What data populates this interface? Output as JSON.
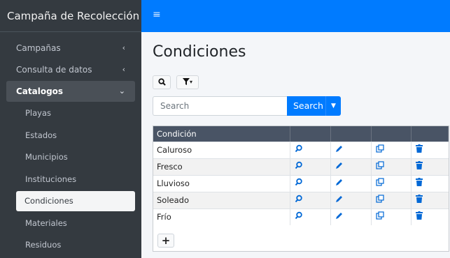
{
  "sidebar": {
    "brand": "Campaña de Recolección",
    "items": [
      {
        "label": "Campañas",
        "chevron": "‹"
      },
      {
        "label": "Consulta de datos",
        "chevron": "‹"
      },
      {
        "label": "Catalogos",
        "chevron": "⌄"
      }
    ],
    "subitems": [
      {
        "label": "Playas"
      },
      {
        "label": "Estados"
      },
      {
        "label": "Municipios"
      },
      {
        "label": "Instituciones"
      },
      {
        "label": "Condiciones"
      },
      {
        "label": "Materiales"
      },
      {
        "label": "Residuos"
      }
    ]
  },
  "topbar": {
    "menu_icon": "≡"
  },
  "main": {
    "title": "Condiciones",
    "toolbar": {
      "search_icon": "🔍",
      "filter_icon": "▼·"
    },
    "search": {
      "placeholder": "Search",
      "button_label": "Search",
      "dropdown_caret": "▼"
    },
    "table": {
      "headers": [
        "Condición",
        "",
        "",
        "",
        ""
      ],
      "rows": [
        "Caluroso",
        "Fresco",
        "Lluvioso",
        "Soleado",
        "Frío"
      ]
    },
    "add_label": "+"
  },
  "colors": {
    "sidebar_bg": "#343a40",
    "accent": "#007bff",
    "table_head": "#495465"
  },
  "icons": {
    "view": "search-icon",
    "edit": "pencil-icon",
    "copy": "copy-icon",
    "delete": "trash-icon"
  }
}
